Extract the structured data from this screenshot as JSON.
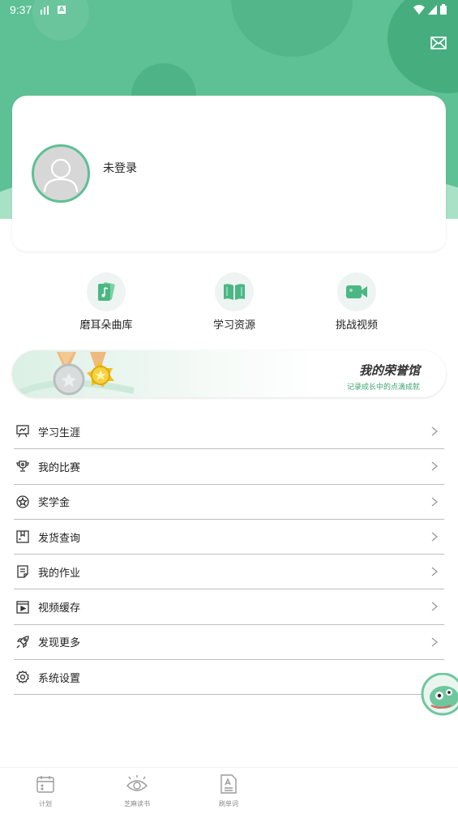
{
  "status_bar": {
    "time": "9:37",
    "badge": "A"
  },
  "profile": {
    "login_label": "未登录"
  },
  "quick_actions": [
    {
      "label": "磨耳朵曲库",
      "icon": "music-cards-icon"
    },
    {
      "label": "学习资源",
      "icon": "open-book-icon"
    },
    {
      "label": "挑战视频",
      "icon": "video-camera-icon"
    }
  ],
  "honor": {
    "title": "我的荣誉馆",
    "subtitle": "记录成长中的点滴成就"
  },
  "menu": [
    {
      "label": "学习生涯",
      "icon": "presentation-chart-icon"
    },
    {
      "label": "我的比赛",
      "icon": "trophy-icon"
    },
    {
      "label": "奖学金",
      "icon": "star-badge-icon"
    },
    {
      "label": "发货查询",
      "icon": "package-icon"
    },
    {
      "label": "我的作业",
      "icon": "document-icon"
    },
    {
      "label": "视频缓存",
      "icon": "video-clip-icon"
    },
    {
      "label": "发现更多",
      "icon": "rocket-icon"
    },
    {
      "label": "系统设置",
      "icon": "gear-icon"
    }
  ],
  "bottom_nav": [
    {
      "label": "计划",
      "icon": "calendar-icon"
    },
    {
      "label": "芝麻读书",
      "icon": "eye-reading-icon"
    },
    {
      "label": "刷单词",
      "icon": "word-sheet-icon"
    }
  ],
  "colors": {
    "brand_green": "#5ec095",
    "light_green": "#a9e1c6"
  }
}
